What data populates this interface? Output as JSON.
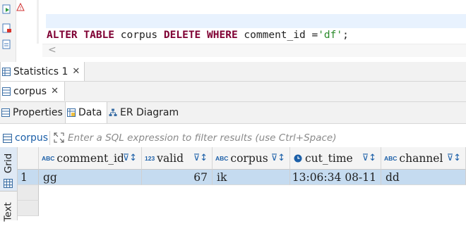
{
  "editor": {
    "sql": {
      "alter": "ALTER",
      "table": "TABLE",
      "corpus": "corpus",
      "delete": "DELETE",
      "where": "WHERE",
      "comment_id": "comment_id",
      "eq": "=",
      "value": "'df'",
      "semicolon": ";"
    },
    "scroll_left_glyph": "<"
  },
  "tabs": {
    "statistics": "Statistics 1",
    "corpus": "corpus",
    "close_glyph": "✕"
  },
  "subtabs": {
    "properties": "Properties",
    "data": "Data",
    "er_diagram": "ER Diagram"
  },
  "filter": {
    "table_name": "corpus",
    "placeholder": "Enter a SQL expression to filter results (use Ctrl+Space)"
  },
  "side_tabs": {
    "grid": "Grid",
    "text": "Text"
  },
  "grid": {
    "columns": [
      {
        "type": "ABC",
        "name": "comment_id"
      },
      {
        "type": "123",
        "name": "valid"
      },
      {
        "type": "ABC",
        "name": "corpus"
      },
      {
        "type": "clock",
        "name": "cut_time"
      },
      {
        "type": "ABC",
        "name": "channel"
      }
    ],
    "sort_glyph": "⊽↕",
    "rows": [
      {
        "num": "1",
        "cells": [
          "gg",
          "67",
          "ik",
          "08-11 13:06:34",
          "dd"
        ]
      }
    ]
  }
}
